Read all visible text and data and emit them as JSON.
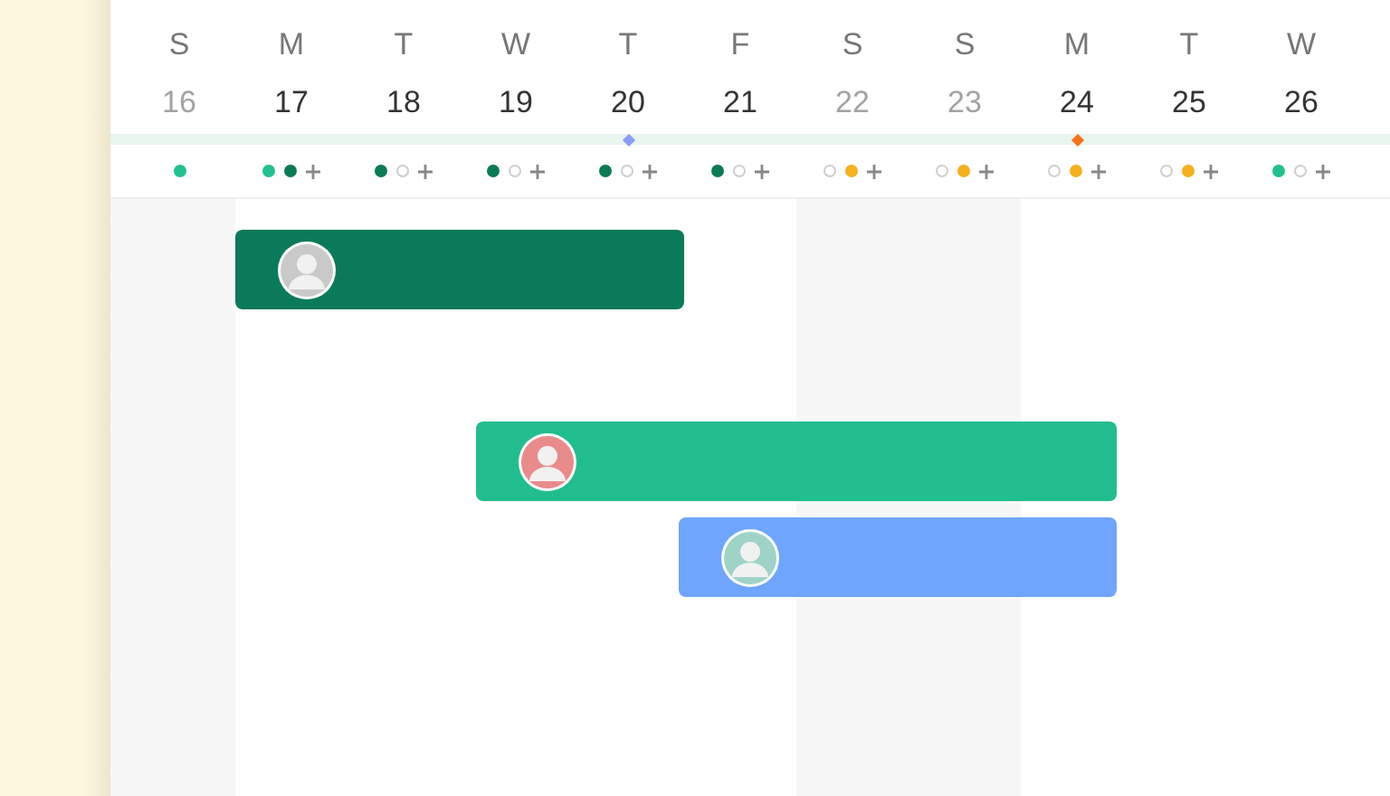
{
  "days": [
    {
      "letter": "S",
      "number": "16",
      "weekend": true,
      "markers": [
        {
          "kind": "dot",
          "color": "#22c08f"
        }
      ]
    },
    {
      "letter": "M",
      "number": "17",
      "weekend": false,
      "markers": [
        {
          "kind": "dot",
          "color": "#22c08f"
        },
        {
          "kind": "dot",
          "color": "#0a7a56"
        },
        {
          "kind": "add"
        }
      ]
    },
    {
      "letter": "T",
      "number": "18",
      "weekend": false,
      "markers": [
        {
          "kind": "dot",
          "color": "#0a7a56"
        },
        {
          "kind": "empty"
        },
        {
          "kind": "add"
        }
      ]
    },
    {
      "letter": "W",
      "number": "19",
      "weekend": false,
      "markers": [
        {
          "kind": "dot",
          "color": "#0a7a56"
        },
        {
          "kind": "empty"
        },
        {
          "kind": "add"
        }
      ]
    },
    {
      "letter": "T",
      "number": "20",
      "weekend": false,
      "milestone": {
        "color": "#8b9cf7"
      },
      "markers": [
        {
          "kind": "dot",
          "color": "#0a7a56"
        },
        {
          "kind": "empty"
        },
        {
          "kind": "add"
        }
      ]
    },
    {
      "letter": "F",
      "number": "21",
      "weekend": false,
      "markers": [
        {
          "kind": "dot",
          "color": "#0a7a56"
        },
        {
          "kind": "empty"
        },
        {
          "kind": "add"
        }
      ]
    },
    {
      "letter": "S",
      "number": "22",
      "weekend": true,
      "markers": [
        {
          "kind": "empty"
        },
        {
          "kind": "dot",
          "color": "#f6b01e"
        },
        {
          "kind": "add"
        }
      ]
    },
    {
      "letter": "S",
      "number": "23",
      "weekend": true,
      "markers": [
        {
          "kind": "empty"
        },
        {
          "kind": "dot",
          "color": "#f6b01e"
        },
        {
          "kind": "add"
        }
      ]
    },
    {
      "letter": "M",
      "number": "24",
      "weekend": false,
      "milestone": {
        "color": "#f97316"
      },
      "markers": [
        {
          "kind": "empty"
        },
        {
          "kind": "dot",
          "color": "#f6b01e"
        },
        {
          "kind": "add"
        }
      ]
    },
    {
      "letter": "T",
      "number": "25",
      "weekend": false,
      "markers": [
        {
          "kind": "empty"
        },
        {
          "kind": "dot",
          "color": "#f6b01e"
        },
        {
          "kind": "add"
        }
      ]
    },
    {
      "letter": "W",
      "number": "26",
      "weekend": false,
      "markers": [
        {
          "kind": "dot",
          "color": "#22c08f"
        },
        {
          "kind": "empty"
        },
        {
          "kind": "add"
        }
      ]
    }
  ],
  "bars": [
    {
      "color": "#0b7a5a"
    },
    {
      "color": "#22bd8e"
    },
    {
      "color": "#6fa5fd"
    }
  ]
}
